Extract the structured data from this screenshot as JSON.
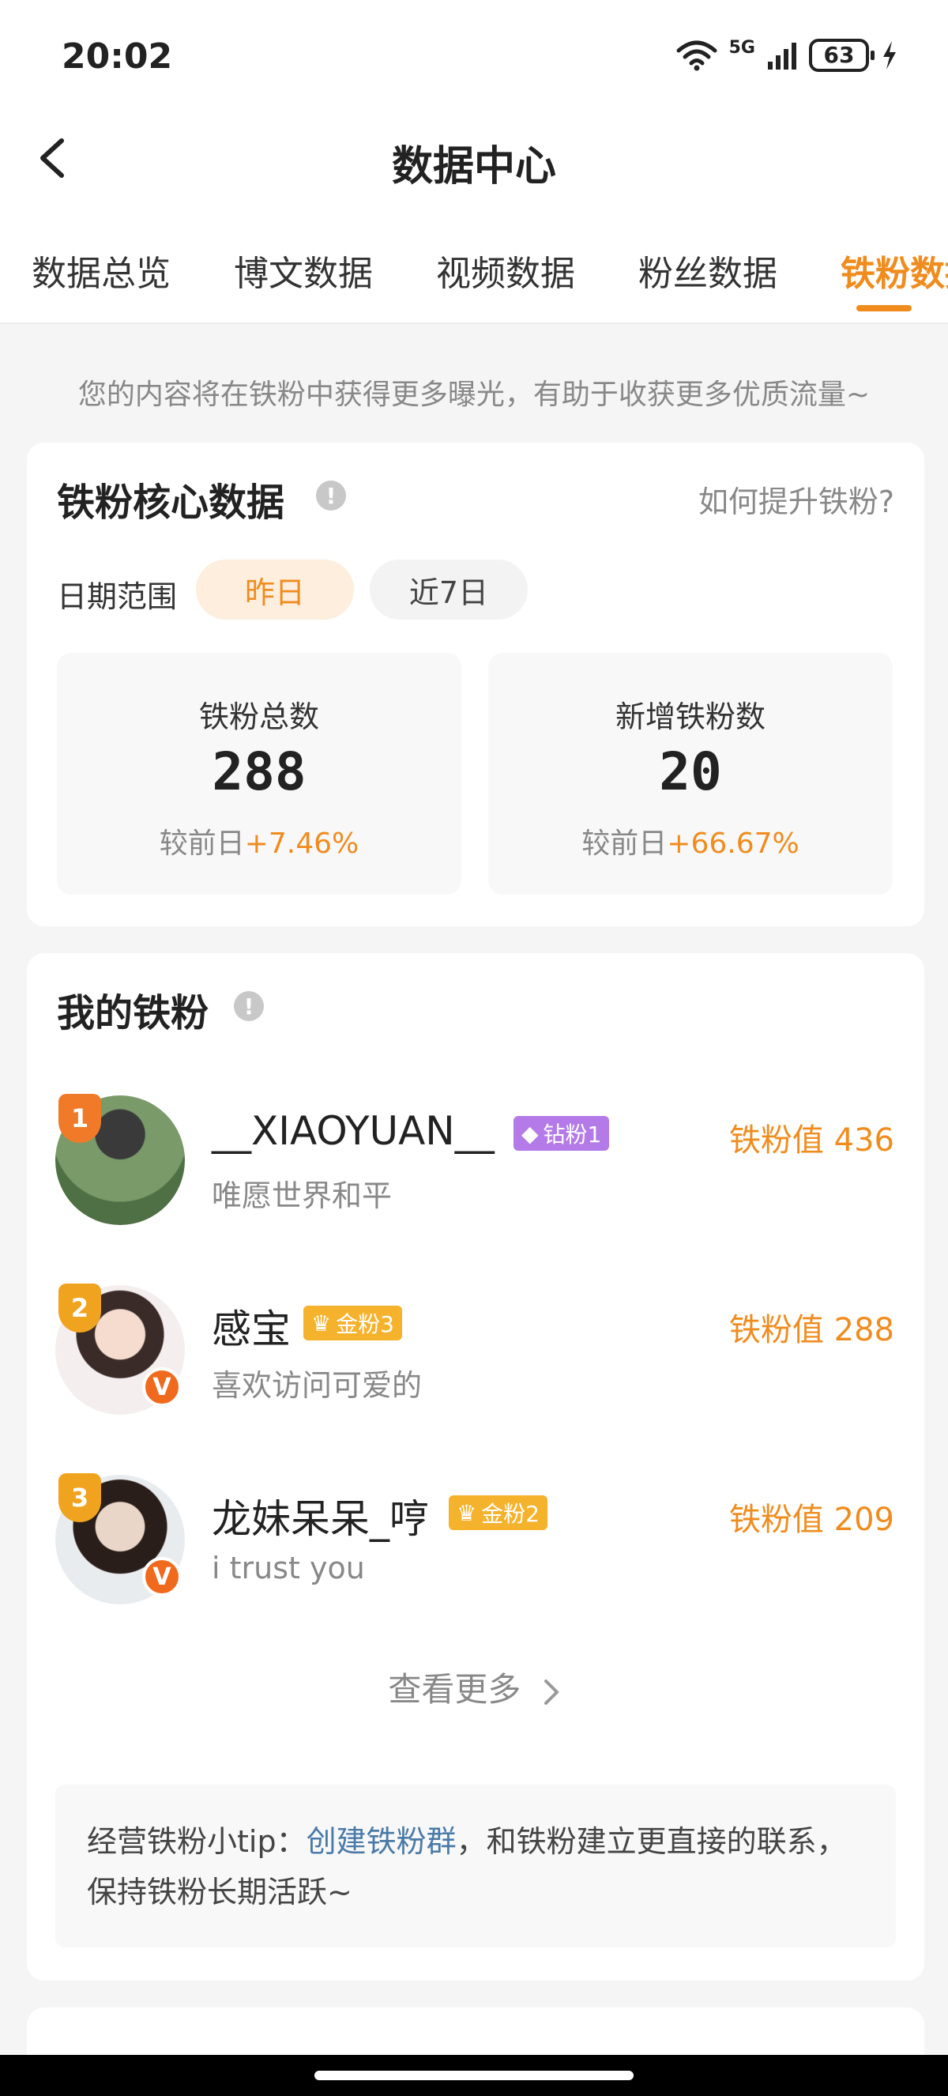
{
  "status": {
    "time": "20:02",
    "network": "5G",
    "battery": "63"
  },
  "nav": {
    "title": "数据中心"
  },
  "tabs": [
    "数据总览",
    "博文数据",
    "视频数据",
    "粉丝数据",
    "铁粉数据"
  ],
  "notice": "您的内容将在铁粉中获得更多曝光，有助于收获更多优质流量~",
  "core": {
    "title": "铁粉核心数据",
    "help": "如何提升铁粉?",
    "date_label": "日期范围",
    "date_options": [
      "昨日",
      "近7日"
    ],
    "selected": "昨日",
    "stats": [
      {
        "label": "铁粉总数",
        "value": "288",
        "compare": "较前日",
        "change": "+7.46%"
      },
      {
        "label": "新增铁粉数",
        "value": "20",
        "compare": "较前日",
        "change": "+66.67%"
      }
    ]
  },
  "my_fans": {
    "title": "我的铁粉",
    "fans": [
      {
        "rank": "1",
        "name": "__XIAOYUAN__",
        "badge": "钻粉1",
        "signature": "唯愿世界和平",
        "score": "铁粉值 436"
      },
      {
        "rank": "2",
        "name": "感宝",
        "badge": "金粉3",
        "signature": "喜欢访问可爱的",
        "score": "铁粉值 288"
      },
      {
        "rank": "3",
        "name": "龙妹呆呆_哼",
        "badge": "金粉2",
        "signature": "i trust you",
        "score": "铁粉值 209"
      }
    ],
    "view_more": "查看更多",
    "tip_prefix": "经营铁粉小tip：",
    "tip_link": "创建铁粉群",
    "tip_suffix": "，和铁粉建立更直接的联系，保持铁粉长期活跃~"
  },
  "colors": {
    "accent": "#f08c1e",
    "diamond": "#b37ae8",
    "gold": "#f5b22c",
    "link": "#4a7aa8"
  }
}
